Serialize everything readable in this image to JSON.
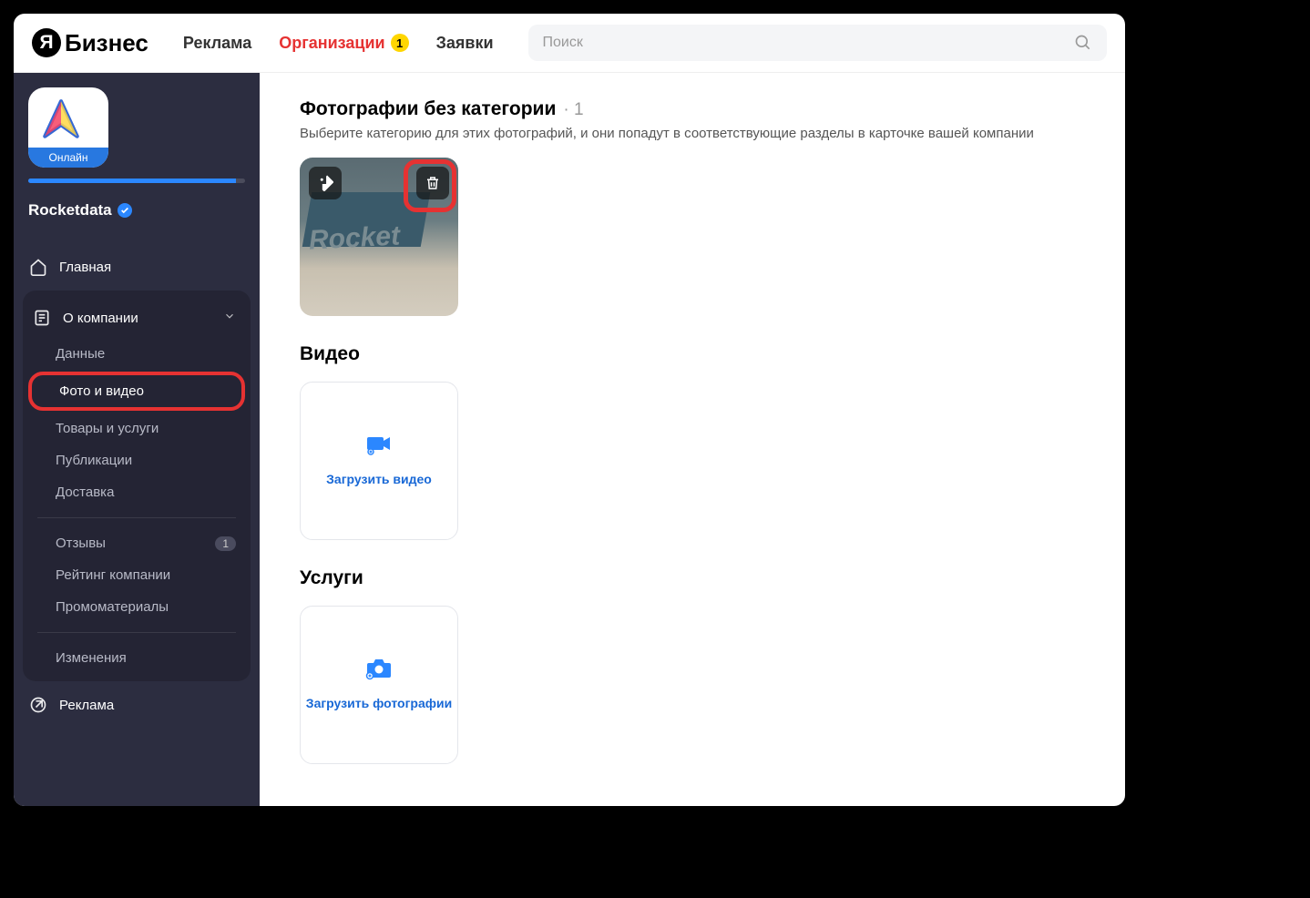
{
  "header": {
    "logo_letter": "Я",
    "logo_text": "Бизнес",
    "nav": {
      "ads": "Реклама",
      "orgs": "Организации",
      "orgs_badge": "1",
      "requests": "Заявки"
    },
    "search_placeholder": "Поиск"
  },
  "sidebar": {
    "app_badge": "Онлайн",
    "org_name": "Rocketdata",
    "menu": {
      "home": "Главная",
      "about": "О компании",
      "ads": "Реклама"
    },
    "submenu": {
      "data": "Данные",
      "photo_video": "Фото и видео",
      "goods": "Товары и услуги",
      "publications": "Публикации",
      "delivery": "Доставка",
      "reviews": "Отзывы",
      "reviews_badge": "1",
      "rating": "Рейтинг компании",
      "promo": "Промоматериалы",
      "changes": "Изменения"
    }
  },
  "content": {
    "uncategorized_title": "Фотографии без категории",
    "uncategorized_count": "1",
    "uncategorized_desc": "Выберите категорию для этих фотографий, и они попадут в соответствующие разделы в карточке вашей компании",
    "video_title": "Видео",
    "upload_video": "Загрузить видео",
    "services_title": "Услуги",
    "upload_photos": "Загрузить фотографии"
  }
}
